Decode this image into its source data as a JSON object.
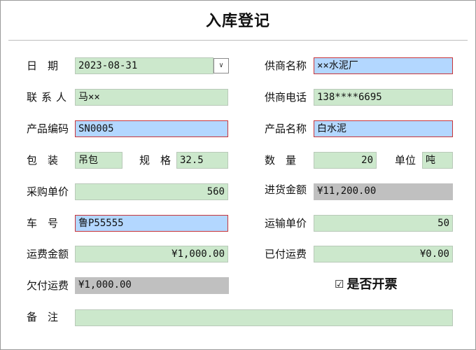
{
  "window": {
    "title": "入库登记"
  },
  "labels": {
    "date": "日　期",
    "supplier_name": "供商名称",
    "contact": "联系人",
    "supplier_phone": "供商电话",
    "product_code": "产品编码",
    "product_name": "产品名称",
    "packaging": "包　装",
    "spec": "规　格",
    "quantity": "数　量",
    "unit": "单位",
    "purchase_price": "采购单价",
    "stock_amount": "进货金额",
    "vehicle": "车　号",
    "freight_price": "运输单价",
    "freight_amount": "运费金额",
    "paid_freight": "已付运费",
    "unpaid_freight": "欠付运费",
    "invoice": "是否开票",
    "remark": "备　注"
  },
  "fields": {
    "date": "2023-08-31",
    "supplier_name": "××水泥厂",
    "contact": "马××",
    "supplier_phone": "138****6695",
    "product_code": "SN0005",
    "product_name": "白水泥",
    "packaging": "吊包",
    "spec": "32.5",
    "quantity": "20",
    "unit": "吨",
    "purchase_price": "560",
    "stock_amount": "¥11,200.00",
    "vehicle": "鲁P55555",
    "freight_price": "50",
    "freight_amount": "¥1,000.00",
    "paid_freight": "¥0.00",
    "unpaid_freight": "¥1,000.00",
    "remark": ""
  },
  "invoice_checked": true,
  "icons": {
    "date_dropdown": "chevron-down-icon",
    "invoice_checkbox": "checkbox-checked-icon"
  },
  "colors": {
    "input_green": "#cce8cc",
    "input_blue": "#b3d7ff",
    "input_readonly": "#c0c0c0",
    "required_border": "#c8353a"
  }
}
